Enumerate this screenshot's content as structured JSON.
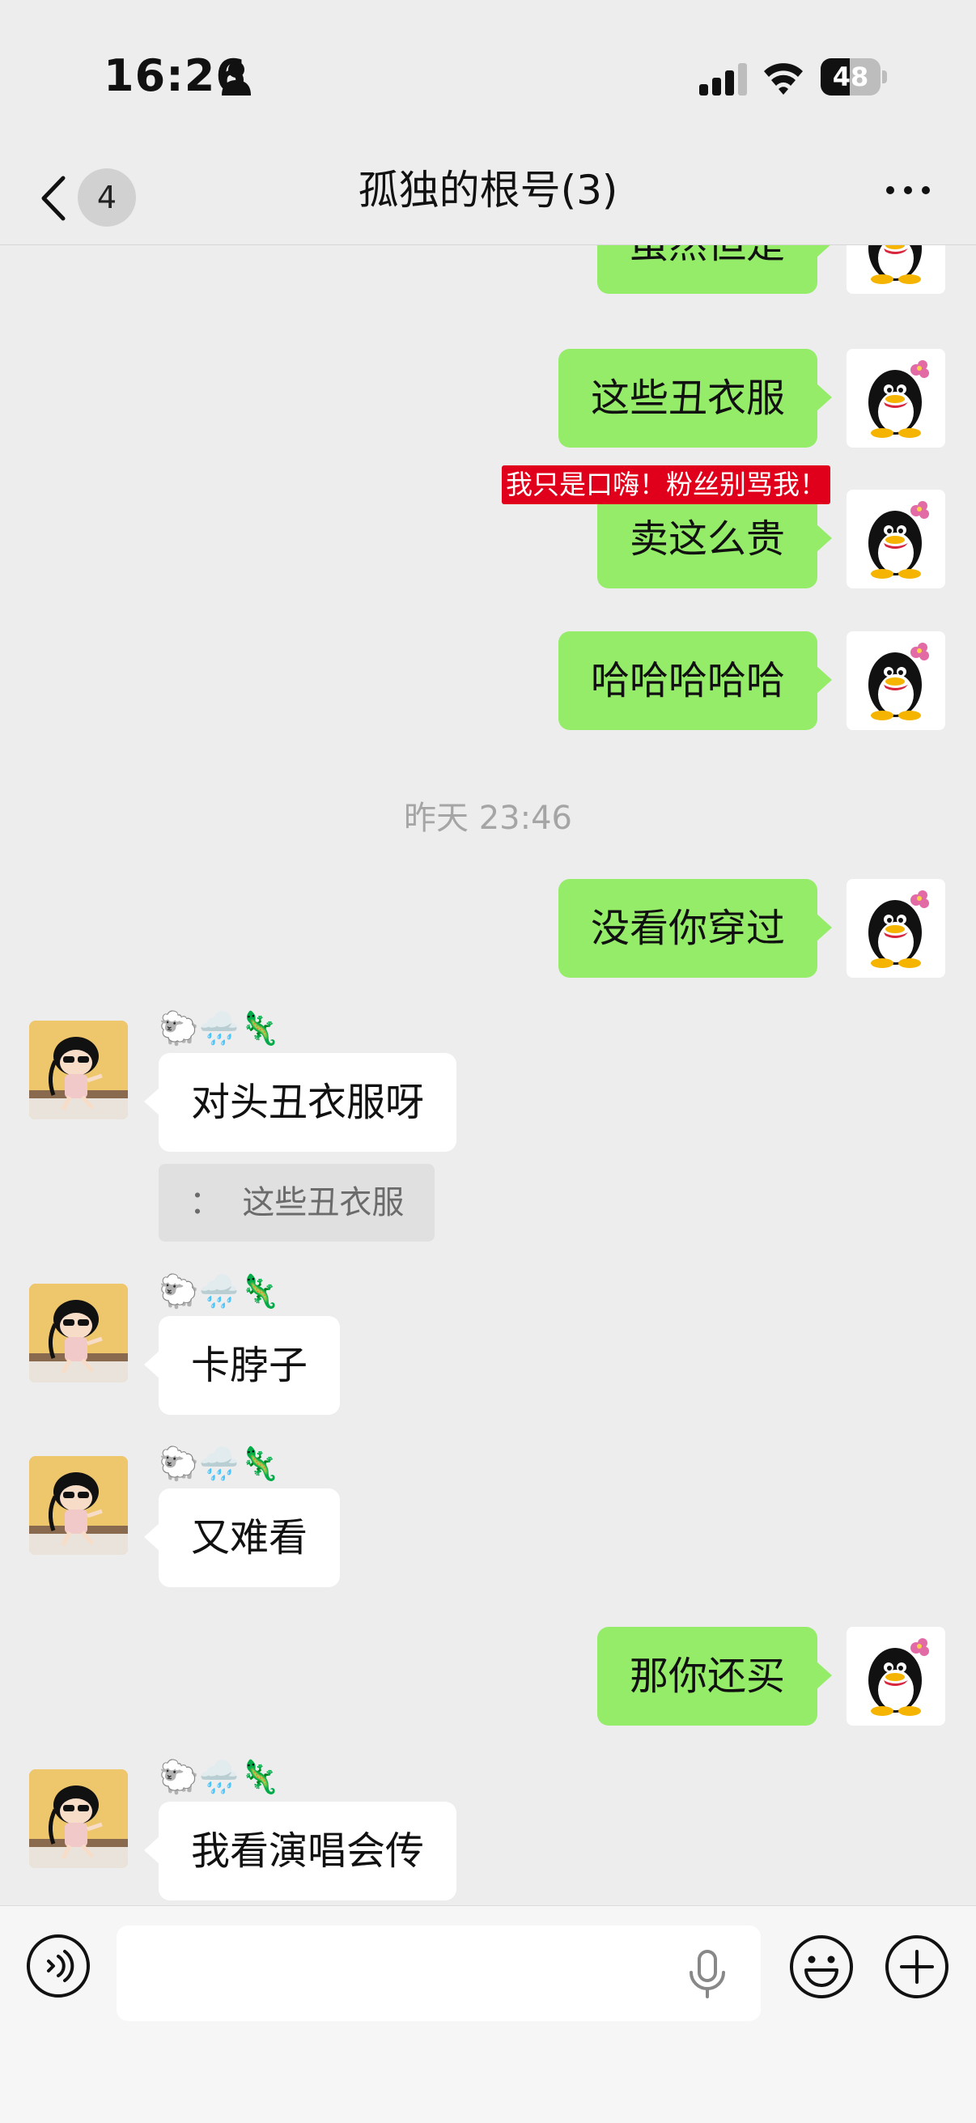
{
  "status_bar": {
    "time": "16:26",
    "battery": "48",
    "battery_level": 0.48
  },
  "header": {
    "unread_count": "4",
    "title": "孤独的根号(3)"
  },
  "overlay_banner": "我只是口嗨！粉丝别骂我！",
  "messages": [
    {
      "side": "self",
      "text": "虽然但是"
    },
    {
      "side": "self",
      "text": "这些丑衣服"
    },
    {
      "side": "self",
      "text": "卖这么贵"
    },
    {
      "side": "self",
      "text": "哈哈哈哈哈"
    },
    {
      "timestamp": "昨天 23:46"
    },
    {
      "side": "self",
      "text": "没看你穿过"
    },
    {
      "side": "other",
      "nickname": "🐑🌧️🦎",
      "text": "对头丑衣服呀",
      "quote": "：  这些丑衣服"
    },
    {
      "side": "other",
      "nickname": "🐑🌧️🦎",
      "text": "卡脖子"
    },
    {
      "side": "other",
      "nickname": "🐑🌧️🦎",
      "text": "又难看"
    },
    {
      "side": "self",
      "text": "那你还买"
    },
    {
      "side": "other",
      "nickname": "🐑🌧️🦎",
      "text": "我看演唱会传"
    }
  ],
  "input_bar": {
    "placeholder": ""
  },
  "colors": {
    "self_bubble": "#95ec69",
    "other_bubble": "#ffffff",
    "background": "#ededed",
    "banner": "#e0001b"
  }
}
